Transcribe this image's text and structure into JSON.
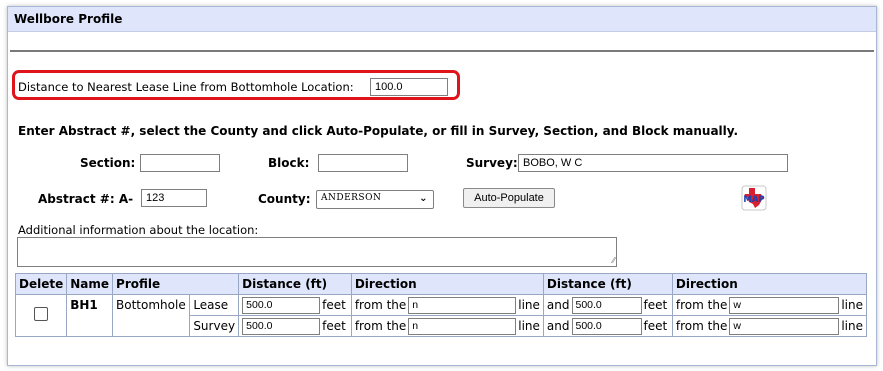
{
  "panel": {
    "title": "Wellbore Profile"
  },
  "distance": {
    "label": "Distance to Nearest Lease Line from Bottomhole Location:",
    "value": "100.0"
  },
  "instruction": "Enter Abstract #, select the County and click Auto-Populate, or fill in Survey, Section, and Block manually.",
  "fields": {
    "section_label": "Section:",
    "section_value": "",
    "block_label": "Block:",
    "block_value": "",
    "survey_label": "Survey:",
    "survey_value": "BOBO, W C",
    "abstract_label": "Abstract #: A-",
    "abstract_value": "123",
    "county_label": "County:",
    "county_value": "ANDERSON",
    "autopopulate_label": "Auto-Populate",
    "map_icon_text": "MAP"
  },
  "additional": {
    "label": "Additional information about the location:",
    "value": ""
  },
  "table": {
    "headers": {
      "delete": "Delete",
      "name": "Name",
      "profile": "Profile",
      "distance1": "Distance (ft)",
      "direction1": "Direction",
      "distance2": "Distance (ft)",
      "direction2": "Direction"
    },
    "row": {
      "name": "BH1",
      "profile": "Bottomhole",
      "feet": "feet",
      "from_the": "from the",
      "line": "line",
      "and": "and",
      "lease": {
        "label": "Lease",
        "dist1": "500.0",
        "dir1": "n",
        "dist2": "500.0",
        "dir2": "w"
      },
      "survey": {
        "label": "Survey",
        "dist1": "500.0",
        "dir1": "n",
        "dist2": "500.0",
        "dir2": "w"
      }
    }
  },
  "colors": {
    "header_bg": "#dfe6fb",
    "highlight": "#e0151c",
    "rule": "#7a7a7a"
  }
}
